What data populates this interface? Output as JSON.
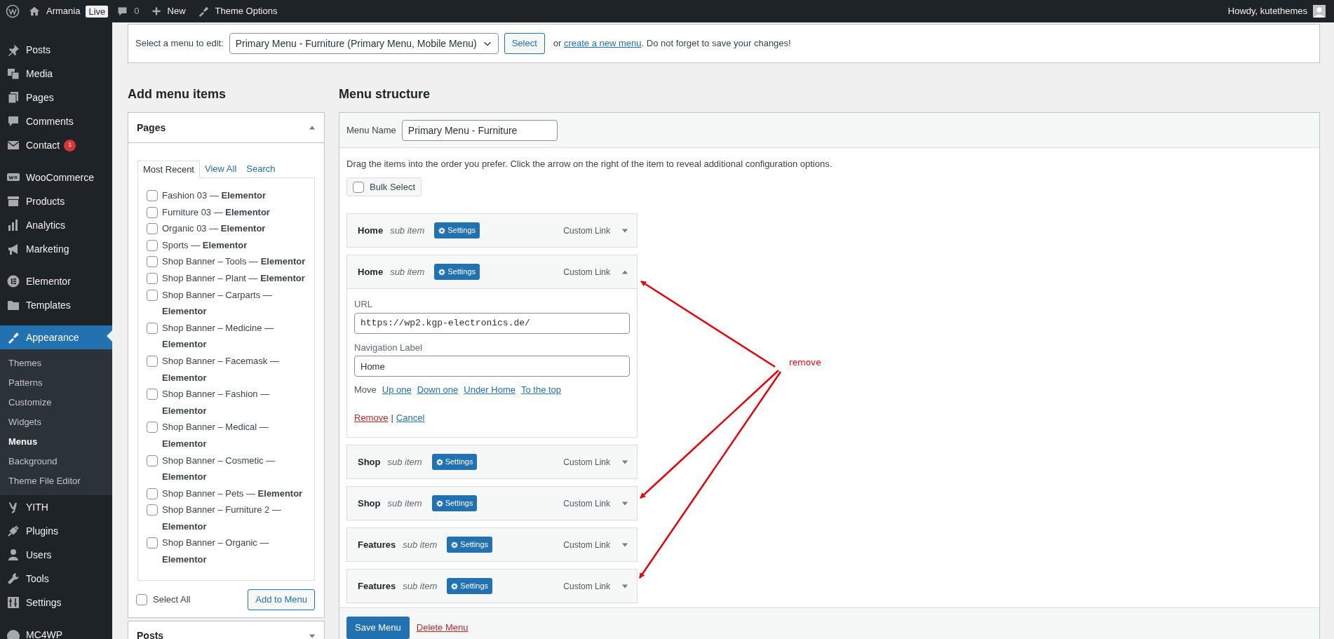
{
  "admin_bar": {
    "site": "Armania",
    "live_badge": "Live",
    "comments_count": "0",
    "new_label": "New",
    "theme_options": "Theme Options",
    "greeting": "Howdy, kutethemes"
  },
  "sidebar": {
    "items": [
      {
        "label": "Posts",
        "selected": false
      },
      {
        "label": "Media",
        "selected": false
      },
      {
        "label": "Pages",
        "selected": false
      },
      {
        "label": "Comments",
        "selected": false
      },
      {
        "label": "Contact",
        "selected": false,
        "badge": "1"
      },
      {
        "label": "WooCommerce",
        "selected": false
      },
      {
        "label": "Products",
        "selected": false
      },
      {
        "label": "Analytics",
        "selected": false
      },
      {
        "label": "Marketing",
        "selected": false
      },
      {
        "label": "Elementor",
        "selected": false
      },
      {
        "label": "Templates",
        "selected": false
      },
      {
        "label": "Appearance",
        "selected": true,
        "children": [
          {
            "label": "Themes",
            "selected": false
          },
          {
            "label": "Patterns",
            "selected": false
          },
          {
            "label": "Customize",
            "selected": false
          },
          {
            "label": "Widgets",
            "selected": false
          },
          {
            "label": "Menus",
            "selected": true
          },
          {
            "label": "Background",
            "selected": false
          },
          {
            "label": "Theme File Editor",
            "selected": false
          }
        ]
      },
      {
        "label": "YITH",
        "selected": false
      },
      {
        "label": "Plugins",
        "selected": false
      },
      {
        "label": "Users",
        "selected": false
      },
      {
        "label": "Tools",
        "selected": false
      },
      {
        "label": "Settings",
        "selected": false
      },
      {
        "label": "MC4WP",
        "selected": false
      }
    ]
  },
  "menu_select": {
    "label": "Select a menu to edit:",
    "value": "Primary Menu - Furniture (Primary Menu, Mobile Menu)",
    "button": "Select",
    "hint_before": "or",
    "link": "create a new menu",
    "hint_after": ". Do not forget to save your changes!"
  },
  "add_menu_items": {
    "heading": "Add menu items",
    "panel_title": "Pages",
    "tabs": [
      {
        "label": "Most Recent",
        "selected": true
      },
      {
        "label": "View All",
        "selected": false
      },
      {
        "label": "Search",
        "selected": false
      }
    ],
    "pages": [
      {
        "label": "Fashion 03 — **Elementor**",
        "checked": false
      },
      {
        "label": "Furniture 03 — **Elementor**",
        "checked": false
      },
      {
        "label": "Organic 03 — **Elementor**",
        "checked": false
      },
      {
        "label": "Sports — **Elementor**",
        "checked": false
      },
      {
        "label": "Shop Banner – Tools — **Elementor**",
        "checked": false
      },
      {
        "label": "Shop Banner – Plant — **Elementor**",
        "checked": false
      },
      {
        "label": "Shop Banner – Carparts — **Elementor**",
        "checked": false
      },
      {
        "label": "Shop Banner – Medicine — **Elementor**",
        "checked": false
      },
      {
        "label": "Shop Banner – Facemask — **Elementor**",
        "checked": false
      },
      {
        "label": "Shop Banner – Fashion — **Elementor**",
        "checked": false
      },
      {
        "label": "Shop Banner – Medical — **Elementor**",
        "checked": false
      },
      {
        "label": "Shop Banner – Cosmetic — **Elementor**",
        "checked": false
      },
      {
        "label": "Shop Banner – Pets — **Elementor**",
        "checked": false
      },
      {
        "label": "Shop Banner – Furniture 2 — **Elementor**",
        "checked": false
      },
      {
        "label": "Shop Banner – Organic — **Elementor**",
        "checked": false
      }
    ],
    "select_all": {
      "label": "Select All",
      "checked": false
    },
    "add_button": "Add to Menu",
    "next_panel_title": "Posts"
  },
  "menu_structure": {
    "heading": "Menu structure",
    "menu_name_label": "Menu Name",
    "menu_name": "Primary Menu - Furniture",
    "instructions": "Drag the items into the order you prefer. Click the arrow on the right of the item to reveal additional configuration options.",
    "bulk_select": {
      "label": "Bulk Select",
      "checked": false
    },
    "items": [
      {
        "title": "Home",
        "subtitle": "sub item",
        "settings": "Settings",
        "type": "Custom Link",
        "expanded": false
      },
      {
        "title": "Home",
        "subtitle": "sub item",
        "settings": "Settings",
        "type": "Custom Link",
        "expanded": true,
        "url_label": "URL",
        "url": "https://wp2.kgp-electronics.de/",
        "nav_label_label": "Navigation Label",
        "nav_label": "Home",
        "move_label": "Move",
        "move_links": [
          "Up one",
          "Down one",
          "Under Home",
          "To the top"
        ],
        "remove": "Remove",
        "separator": "|",
        "cancel": "Cancel"
      },
      {
        "title": "Shop",
        "subtitle": "sub item",
        "settings": "Settings",
        "type": "Custom Link",
        "expanded": false
      },
      {
        "title": "Shop",
        "subtitle": "sub item",
        "settings": "Settings",
        "type": "Custom Link",
        "expanded": false
      },
      {
        "title": "Features",
        "subtitle": "sub item",
        "settings": "Settings",
        "type": "Custom Link",
        "expanded": false
      },
      {
        "title": "Features",
        "subtitle": "sub item",
        "settings": "Settings",
        "type": "Custom Link",
        "expanded": false
      }
    ],
    "save_button": "Save Menu",
    "delete_link": "Delete Menu"
  },
  "annotation": {
    "label": "remove"
  }
}
